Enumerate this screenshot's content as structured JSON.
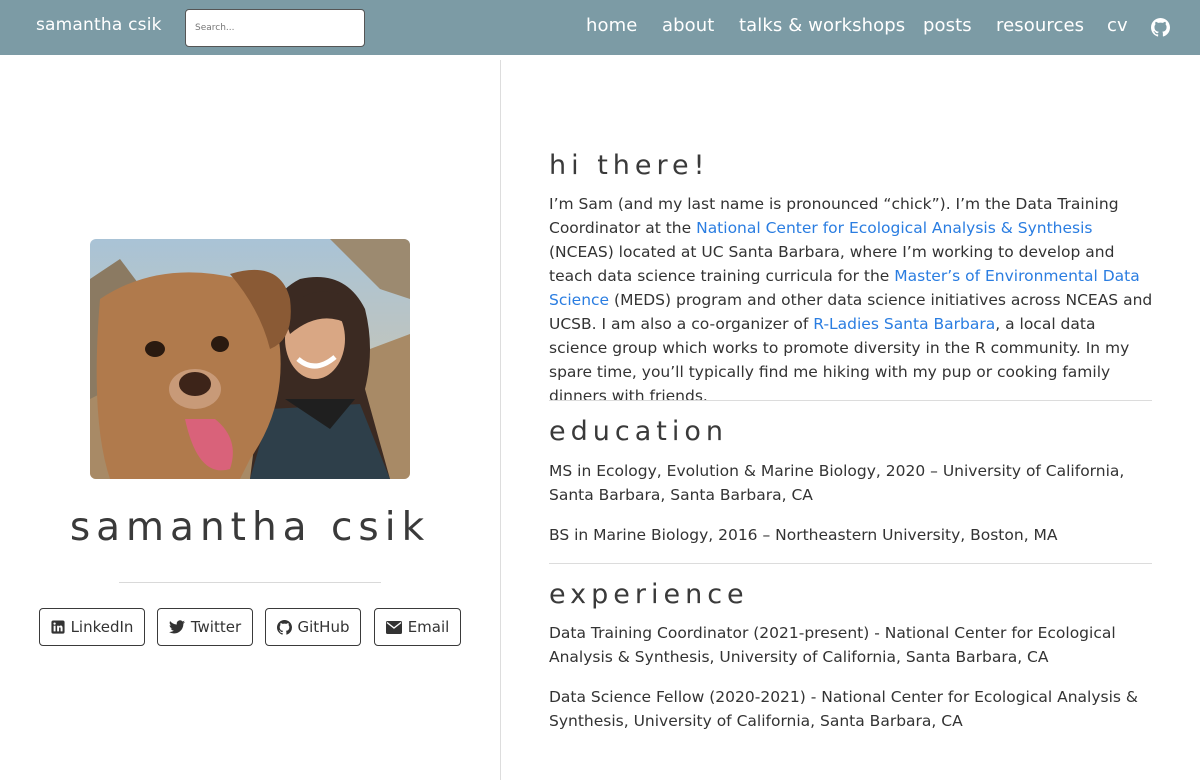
{
  "navbar": {
    "brand": "samantha csik",
    "search_placeholder": "Search...",
    "links": [
      "home",
      "about",
      "talks & workshops",
      "posts",
      "resources",
      "cv"
    ],
    "github_icon": "github-icon"
  },
  "profile": {
    "name": "samantha csik",
    "photo_alt": "profile photo",
    "buttons": [
      {
        "label": "LinkedIn",
        "icon": "linkedin-icon"
      },
      {
        "label": "Twitter",
        "icon": "twitter-icon"
      },
      {
        "label": "GitHub",
        "icon": "github-icon"
      },
      {
        "label": "Email",
        "icon": "envelope-icon"
      }
    ]
  },
  "intro": {
    "title": "hi there!",
    "t1": "I’m Sam (and my last name is pronounced “chick”). I’m the Data Training Coordinator at the ",
    "link1": "National Center for Ecological Analysis & Synthesis",
    "t2": " (NCEAS) located at UC Santa Barbara, where I’m working to develop and teach data science training curricula for the ",
    "link2": "Master’s of Environmental Data Science",
    "t3": " (MEDS) program and other data science initiatives across NCEAS and UCSB. I am also a co-organizer of ",
    "link3": "R-Ladies Santa Barbara",
    "t4": ", a local data science group which works to promote diversity in the R community. In my spare time, you’ll typically find me hiking with my pup or cooking family dinners with friends."
  },
  "education": {
    "title": "education",
    "items": [
      "MS in Ecology, Evolution & Marine Biology, 2020 – University of California, Santa Barbara, Santa Barbara, CA",
      "BS in Marine Biology, 2016 – Northeastern University, Boston, MA"
    ]
  },
  "experience": {
    "title": "experience",
    "items": [
      "Data Training Coordinator (2021-present) - National Center for Ecological Analysis & Synthesis, University of California, Santa Barbara, CA",
      "Data Science Fellow (2020-2021) - National Center for Ecological Analysis & Synthesis, University of California, Santa Barbara, CA"
    ]
  },
  "colors": {
    "navbar": "#7c9ba5",
    "link": "#2a7de1",
    "text": "#333333"
  }
}
